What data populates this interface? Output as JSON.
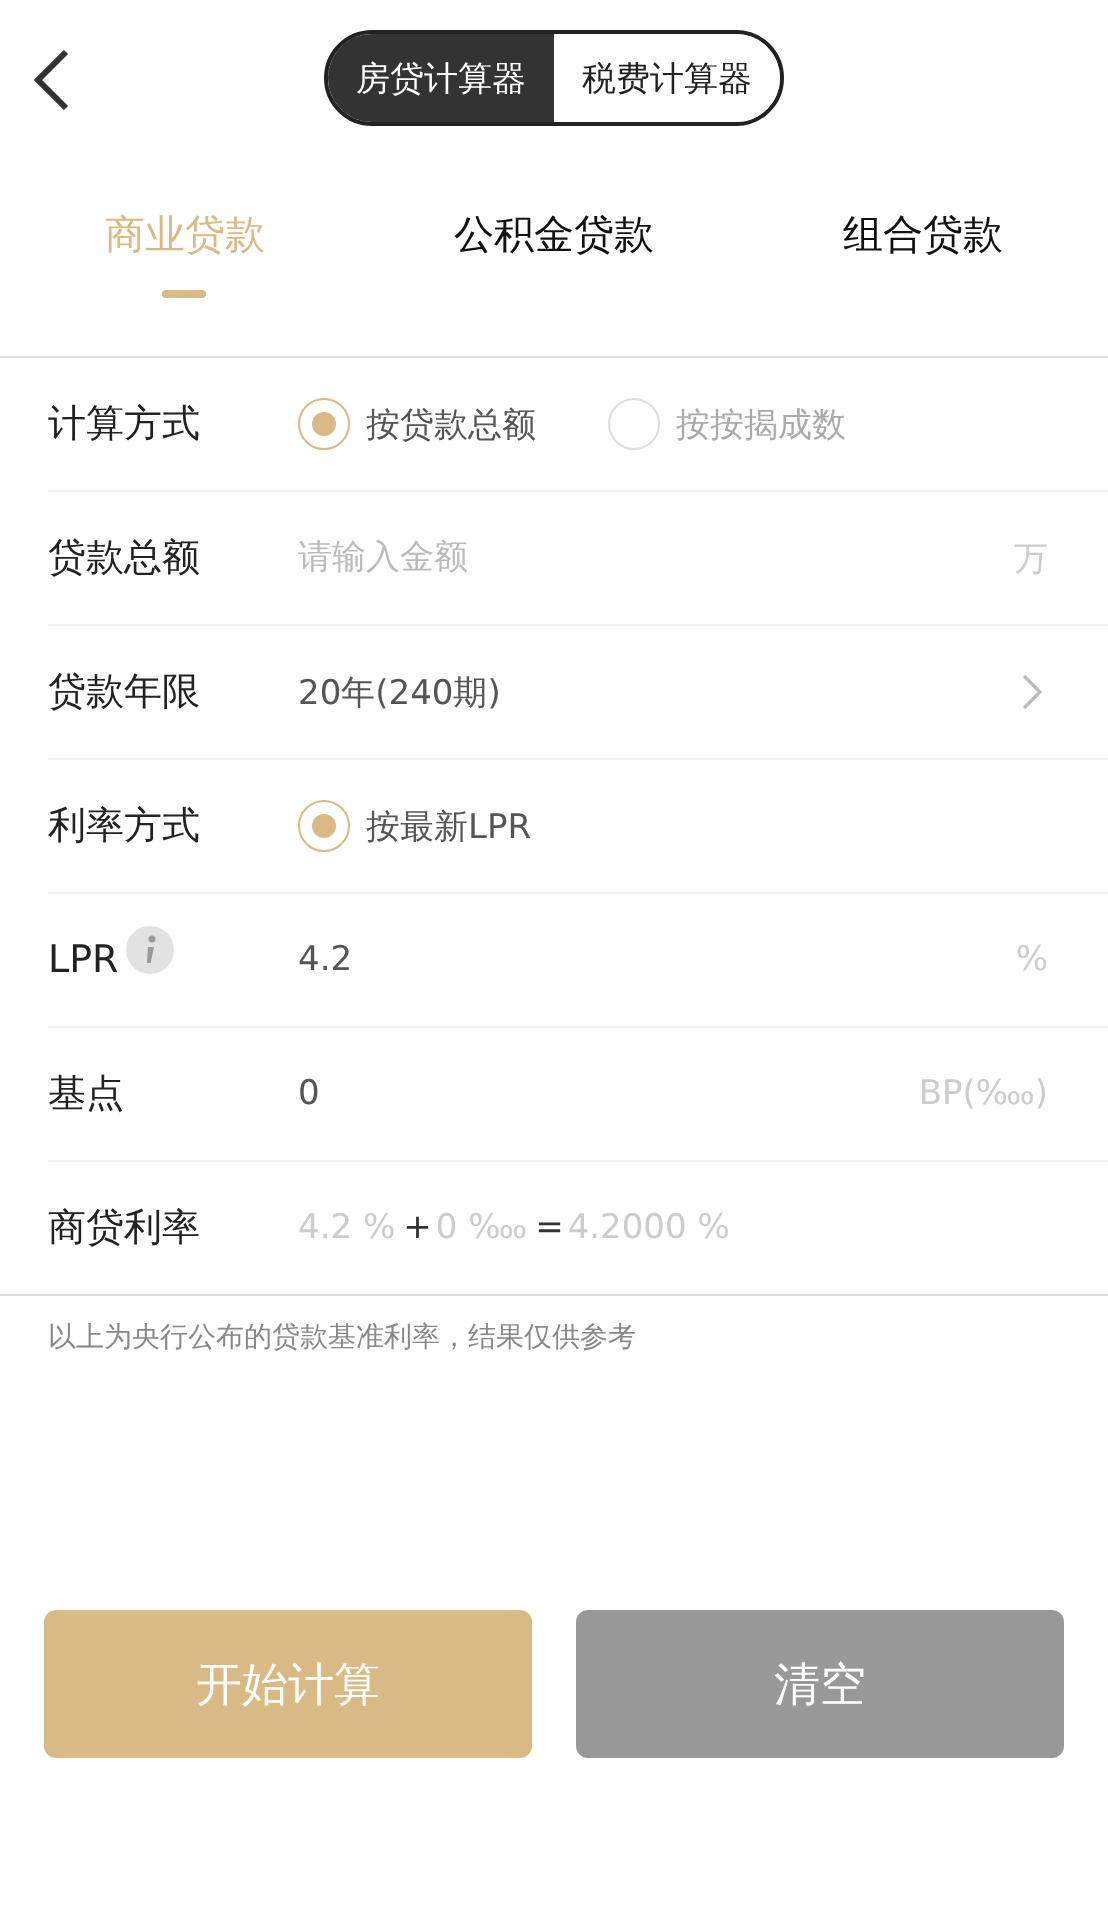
{
  "header": {
    "segments": [
      {
        "label": "房贷计算器",
        "selected": true
      },
      {
        "label": "税费计算器",
        "selected": false
      }
    ]
  },
  "tabs": [
    {
      "label": "商业贷款",
      "selected": true
    },
    {
      "label": "公积金贷款",
      "selected": false
    },
    {
      "label": "组合贷款",
      "selected": false
    }
  ],
  "rows": [
    {
      "kind": "radio",
      "label": "计算方式",
      "options": [
        {
          "label": "按贷款总额",
          "selected": true
        },
        {
          "label": "按按揭成数",
          "selected": false
        }
      ]
    },
    {
      "kind": "input",
      "label": "贷款总额",
      "placeholder": "请输入金额",
      "unit": "万"
    },
    {
      "kind": "select",
      "label": "贷款年限",
      "value": "20年(240期)"
    },
    {
      "kind": "radio",
      "label": "利率方式",
      "options": [
        {
          "label": "按最新LPR",
          "selected": true
        }
      ]
    },
    {
      "kind": "input",
      "label": "LPR",
      "info": true,
      "value": "4.2",
      "unit": "%"
    },
    {
      "kind": "input",
      "label": "基点",
      "value": "0",
      "unit": "BP(‱)"
    },
    {
      "kind": "formula",
      "label": "商贷利率",
      "parts": [
        {
          "kind": "term",
          "text": "4.2 %"
        },
        {
          "kind": "operator",
          "text": "+"
        },
        {
          "kind": "term",
          "text": "0 ‱"
        },
        {
          "kind": "operator",
          "text": "="
        },
        {
          "kind": "term",
          "text": "4.2000 %"
        }
      ]
    }
  ],
  "note": "以上为央行公布的贷款基准利率，结果仅供参考",
  "buttons": [
    {
      "kind": "primary",
      "label": "开始计算"
    },
    {
      "kind": "secondary",
      "label": "清空"
    }
  ]
}
